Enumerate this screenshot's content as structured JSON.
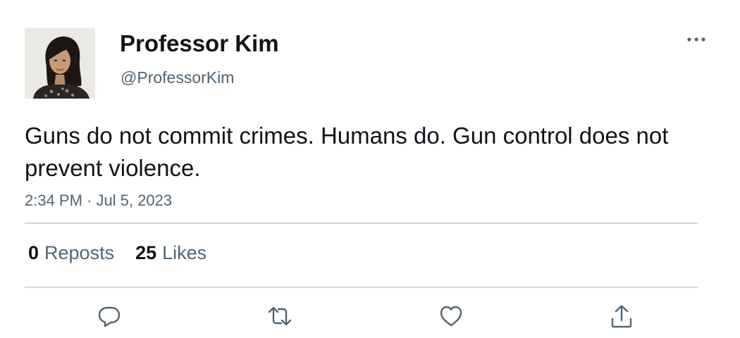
{
  "author": {
    "display_name": "Professor Kim",
    "handle": "@ProfessorKim"
  },
  "tweet": {
    "text": "Guns do not commit crimes. Humans do. Gun control does not prevent violence.",
    "timestamp": "2:34 PM · Jul 5, 2023"
  },
  "stats": {
    "reposts_count": "0",
    "reposts_label": "Reposts",
    "likes_count": "25",
    "likes_label": "Likes"
  },
  "icons": {
    "more": "more-horizontal-icon",
    "reply": "reply-bubble-icon",
    "repost": "repost-arrows-icon",
    "like": "heart-icon",
    "share": "share-upload-icon"
  },
  "colors": {
    "text_primary": "#0f1419",
    "text_secondary": "#536471",
    "divider": "#cfd9de",
    "icon": "#536471"
  }
}
